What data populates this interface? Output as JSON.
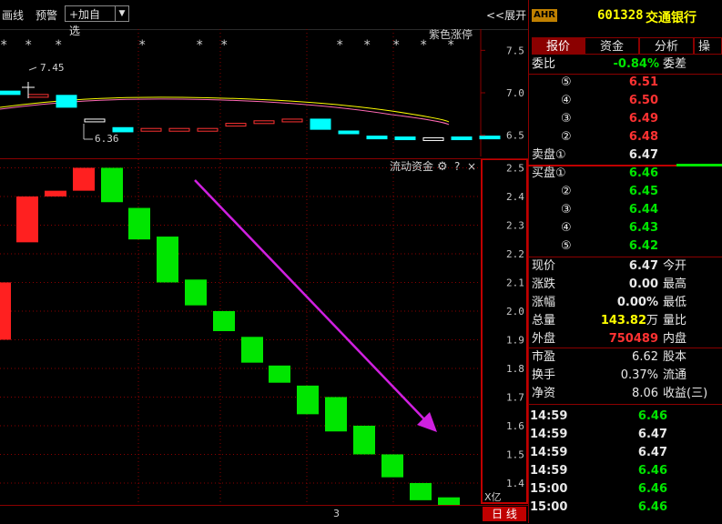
{
  "toolbar": {
    "draw_line": "画线",
    "alert": "预警",
    "add_watch": "+加自选",
    "dropdown_arrow": "▼",
    "expand": "<<展开"
  },
  "upper_chart": {
    "indicator_label": "紫色涨停",
    "high_label": "7.45",
    "low_label": "6.36",
    "y_ticks": [
      "7.5",
      "7.0",
      "6.5"
    ],
    "y_range": [
      6.25,
      7.75
    ],
    "candles": [
      {
        "open": 7.02,
        "close": 6.98
      },
      {
        "open": 6.95,
        "close": 6.98
      },
      {
        "open": 6.97,
        "close": 6.83
      },
      {
        "open": 6.69,
        "close": 6.69
      },
      {
        "open": 6.59,
        "close": 6.54
      },
      {
        "open": 6.56,
        "close": 6.58
      },
      {
        "open": 6.56,
        "close": 6.58
      },
      {
        "open": 6.56,
        "close": 6.58
      },
      {
        "open": 6.62,
        "close": 6.64
      },
      {
        "open": 6.64,
        "close": 6.67
      },
      {
        "open": 6.68,
        "close": 6.69
      },
      {
        "open": 6.69,
        "close": 6.57
      },
      {
        "open": 6.55,
        "close": 6.52
      },
      {
        "open": 6.49,
        "close": 6.47
      },
      {
        "open": 6.48,
        "close": 6.47
      },
      {
        "open": 6.47,
        "close": 6.47
      },
      {
        "open": 6.48,
        "close": 6.47
      },
      {
        "open": 6.49,
        "close": 6.47
      }
    ],
    "star_marker": "*"
  },
  "lower_chart": {
    "title": "流动资金",
    "gear_icon": "gear",
    "help_label": "?",
    "close_label": "×",
    "unit_label": "X亿",
    "y_ticks": [
      "2.5",
      "2.4",
      "2.3",
      "2.2",
      "2.1",
      "2.0",
      "1.9",
      "1.8",
      "1.7",
      "1.6",
      "1.5",
      "1.4"
    ],
    "y_range": [
      1.33,
      2.53
    ],
    "bars": [
      {
        "top": 2.1,
        "bottom": 1.9
      },
      {
        "top": 2.4,
        "bottom": 2.24
      },
      {
        "top": 2.42,
        "bottom": 2.4
      },
      {
        "top": 2.5,
        "bottom": 2.42
      },
      {
        "top": 2.5,
        "bottom": 2.38
      },
      {
        "top": 2.36,
        "bottom": 2.25
      },
      {
        "top": 2.26,
        "bottom": 2.1
      },
      {
        "top": 2.11,
        "bottom": 2.02
      },
      {
        "top": 2.0,
        "bottom": 1.93
      },
      {
        "top": 1.91,
        "bottom": 1.82
      },
      {
        "top": 1.81,
        "bottom": 1.75
      },
      {
        "top": 1.74,
        "bottom": 1.64
      },
      {
        "top": 1.7,
        "bottom": 1.58
      },
      {
        "top": 1.6,
        "bottom": 1.5
      },
      {
        "top": 1.5,
        "bottom": 1.42
      },
      {
        "top": 1.4,
        "bottom": 1.34
      },
      {
        "top": 1.35,
        "bottom": 1.31
      }
    ]
  },
  "bottom_bar": {
    "page_num": "3",
    "period": "日 线"
  },
  "panel": {
    "badge": "AHR",
    "code": "601328",
    "name": "交通银行",
    "tabs": [
      "报价",
      "资金",
      "分析",
      "操"
    ],
    "weibi_label": "委比",
    "weibi_value": "-0.84%",
    "weicha_label": "委差",
    "asks": [
      {
        "label": "⑤",
        "price": "6.51"
      },
      {
        "label": "④",
        "price": "6.50"
      },
      {
        "label": "③",
        "price": "6.49"
      },
      {
        "label": "②",
        "price": "6.48"
      },
      {
        "label": "卖盘①",
        "price": "6.47"
      }
    ],
    "bids": [
      {
        "label": "买盘①",
        "price": "6.46"
      },
      {
        "label": "②",
        "price": "6.45"
      },
      {
        "label": "③",
        "price": "6.44"
      },
      {
        "label": "④",
        "price": "6.43"
      },
      {
        "label": "⑤",
        "price": "6.42"
      }
    ],
    "stats": [
      {
        "label": "现价",
        "value": "6.47",
        "label2": "今开",
        "color": "white"
      },
      {
        "label": "涨跌",
        "value": "0.00",
        "label2": "最高",
        "color": "white"
      },
      {
        "label": "涨幅",
        "value": "0.00%",
        "label2": "最低",
        "color": "white"
      },
      {
        "label": "总量",
        "value": "143.82",
        "unit": "万",
        "label2": "量比",
        "color": "yellow"
      },
      {
        "label": "外盘",
        "value": "750489",
        "label2": "内盘",
        "color": "red"
      }
    ],
    "stats2": [
      {
        "label": "市盈",
        "value": "6.62",
        "label2": "股本"
      },
      {
        "label": "换手",
        "value": "0.37%",
        "label2": "流通"
      },
      {
        "label": "净资",
        "value": "8.06",
        "label2": "收益(三)"
      }
    ],
    "ticks": [
      {
        "time": "14:59",
        "price": "6.46",
        "color": "green"
      },
      {
        "time": "14:59",
        "price": "6.47",
        "color": "white"
      },
      {
        "time": "14:59",
        "price": "6.47",
        "color": "white"
      },
      {
        "time": "14:59",
        "price": "6.46",
        "color": "green"
      },
      {
        "time": "15:00",
        "price": "6.46",
        "color": "green"
      },
      {
        "time": "15:00",
        "price": "6.46",
        "color": "green"
      }
    ]
  },
  "colors": {
    "up": "#ff2020",
    "down": "#00e600",
    "flat_candle": "#00ffff",
    "arrow": "#d020e0",
    "grid": "#8b0000"
  }
}
